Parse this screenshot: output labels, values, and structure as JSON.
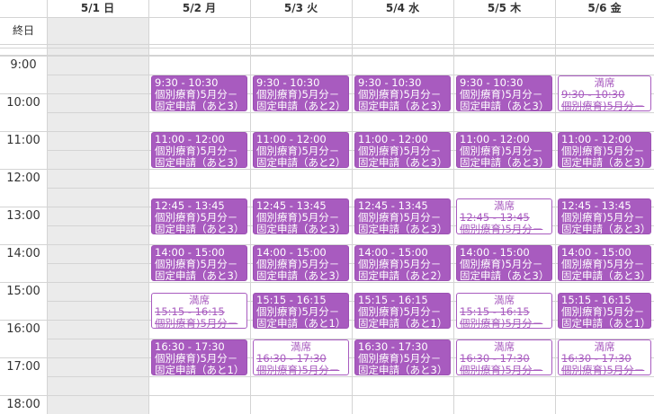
{
  "days": [
    {
      "label": "5/1 日",
      "weekend": true
    },
    {
      "label": "5/2 月",
      "weekend": false
    },
    {
      "label": "5/3 火",
      "weekend": false
    },
    {
      "label": "5/4 水",
      "weekend": false
    },
    {
      "label": "5/5 木",
      "weekend": false
    },
    {
      "label": "5/6 金",
      "weekend": false
    }
  ],
  "allday_label": "終日",
  "hours": [
    "9:00",
    "10:00",
    "11:00",
    "12:00",
    "13:00",
    "14:00",
    "15:00",
    "16:00",
    "17:00",
    "18:00"
  ],
  "full_label": "満席",
  "event_name_line1": "個別療育)5月分－",
  "colors": {
    "event": "#a85bbf",
    "weekend_shade": "#ebebeb",
    "grid": "#d4d4d4"
  },
  "events": [
    {
      "day": 1,
      "start": "9:30",
      "end": "10:30",
      "time": "9:30 - 10:30",
      "line2": "固定申請（あと3）",
      "full": false
    },
    {
      "day": 2,
      "start": "9:30",
      "end": "10:30",
      "time": "9:30 - 10:30",
      "line2": "固定申請（あと2）",
      "full": false
    },
    {
      "day": 3,
      "start": "9:30",
      "end": "10:30",
      "time": "9:30 - 10:30",
      "line2": "固定申請（あと3）",
      "full": false
    },
    {
      "day": 4,
      "start": "9:30",
      "end": "10:30",
      "time": "9:30 - 10:30",
      "line2": "固定申請（あと3）",
      "full": false
    },
    {
      "day": 5,
      "start": "9:30",
      "end": "10:30",
      "time": "9:30 - 10:30",
      "line2": "",
      "full": true
    },
    {
      "day": 1,
      "start": "11:00",
      "end": "12:00",
      "time": "11:00 - 12:00",
      "line2": "固定申請（あと3）",
      "full": false
    },
    {
      "day": 2,
      "start": "11:00",
      "end": "12:00",
      "time": "11:00 - 12:00",
      "line2": "固定申請（あと2）",
      "full": false
    },
    {
      "day": 3,
      "start": "11:00",
      "end": "12:00",
      "time": "11:00 - 12:00",
      "line2": "固定申請（あと3）",
      "full": false
    },
    {
      "day": 4,
      "start": "11:00",
      "end": "12:00",
      "time": "11:00 - 12:00",
      "line2": "固定申請（あと3）",
      "full": false
    },
    {
      "day": 5,
      "start": "11:00",
      "end": "12:00",
      "time": "11:00 - 12:00",
      "line2": "固定申請（あと3）",
      "full": false
    },
    {
      "day": 1,
      "start": "12:45",
      "end": "13:45",
      "time": "12:45 - 13:45",
      "line2": "固定申請（あと3）",
      "full": false
    },
    {
      "day": 2,
      "start": "12:45",
      "end": "13:45",
      "time": "12:45 - 13:45",
      "line2": "固定申請（あと3）",
      "full": false
    },
    {
      "day": 3,
      "start": "12:45",
      "end": "13:45",
      "time": "12:45 - 13:45",
      "line2": "固定申請（あと3）",
      "full": false
    },
    {
      "day": 4,
      "start": "12:45",
      "end": "13:45",
      "time": "12:45 - 13:45",
      "line2": "",
      "full": true
    },
    {
      "day": 5,
      "start": "12:45",
      "end": "13:45",
      "time": "12:45 - 13:45",
      "line2": "固定申請（あと3）",
      "full": false
    },
    {
      "day": 1,
      "start": "14:00",
      "end": "15:00",
      "time": "14:00 - 15:00",
      "line2": "固定申請（あと3）",
      "full": false
    },
    {
      "day": 2,
      "start": "14:00",
      "end": "15:00",
      "time": "14:00 - 15:00",
      "line2": "固定申請（あと3）",
      "full": false
    },
    {
      "day": 3,
      "start": "14:00",
      "end": "15:00",
      "time": "14:00 - 15:00",
      "line2": "固定申請（あと2）",
      "full": false
    },
    {
      "day": 4,
      "start": "14:00",
      "end": "15:00",
      "time": "14:00 - 15:00",
      "line2": "固定申請（あと3）",
      "full": false
    },
    {
      "day": 5,
      "start": "14:00",
      "end": "15:00",
      "time": "14:00 - 15:00",
      "line2": "固定申請（あと3）",
      "full": false
    },
    {
      "day": 1,
      "start": "15:15",
      "end": "16:15",
      "time": "15:15 - 16:15",
      "line2": "",
      "full": true
    },
    {
      "day": 2,
      "start": "15:15",
      "end": "16:15",
      "time": "15:15 - 16:15",
      "line2": "固定申請（あと1）",
      "full": false
    },
    {
      "day": 3,
      "start": "15:15",
      "end": "16:15",
      "time": "15:15 - 16:15",
      "line2": "固定申請（あと1）",
      "full": false
    },
    {
      "day": 4,
      "start": "15:15",
      "end": "16:15",
      "time": "15:15 - 16:15",
      "line2": "",
      "full": true
    },
    {
      "day": 5,
      "start": "15:15",
      "end": "16:15",
      "time": "15:15 - 16:15",
      "line2": "固定申請（あと1）",
      "full": false
    },
    {
      "day": 1,
      "start": "16:30",
      "end": "17:30",
      "time": "16:30 - 17:30",
      "line2": "固定申請（あと1）",
      "full": false
    },
    {
      "day": 2,
      "start": "16:30",
      "end": "17:30",
      "time": "16:30 - 17:30",
      "line2": "",
      "full": true
    },
    {
      "day": 3,
      "start": "16:30",
      "end": "17:30",
      "time": "16:30 - 17:30",
      "line2": "固定申請（あと3）",
      "full": false
    },
    {
      "day": 4,
      "start": "16:30",
      "end": "17:30",
      "time": "16:30 - 17:30",
      "line2": "",
      "full": true
    },
    {
      "day": 5,
      "start": "16:30",
      "end": "17:30",
      "time": "16:30 - 17:30",
      "line2": "",
      "full": true
    }
  ]
}
